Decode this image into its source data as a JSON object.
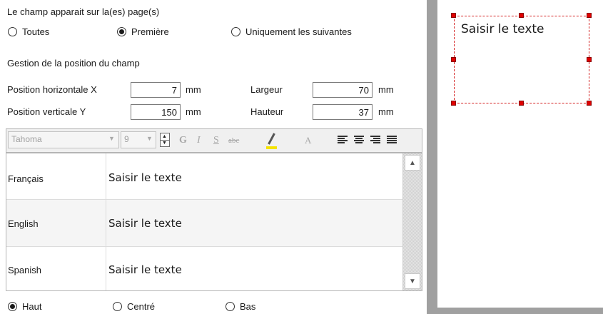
{
  "pages": {
    "heading": "Le champ apparait sur la(es) page(s)",
    "options": [
      {
        "label": "Toutes",
        "selected": false
      },
      {
        "label": "Première",
        "selected": true
      },
      {
        "label": "Uniquement les suivantes",
        "selected": false
      }
    ]
  },
  "position": {
    "heading": "Gestion de la position du champ",
    "horizontal_label": "Position horizontale X",
    "horizontal_value": "7",
    "vertical_label": "Position verticale Y",
    "vertical_value": "150",
    "width_label": "Largeur",
    "width_value": "70",
    "height_label": "Hauteur",
    "height_value": "37",
    "unit": "mm"
  },
  "toolbar": {
    "font": "Tahoma",
    "size": "9",
    "bold": "G",
    "italic": "I",
    "underline": "S",
    "strike": "abc",
    "font_color": "A",
    "highlight_color": "#f5e300",
    "icons": [
      "spin-icon",
      "bold-icon",
      "italic-icon",
      "underline-icon",
      "strikethrough-icon",
      "highlight-pen-icon",
      "font-color-icon",
      "align-left-icon",
      "align-center-icon",
      "align-right-icon",
      "align-justify-icon"
    ]
  },
  "translations": [
    {
      "language": "Français",
      "text": "Saisir le texte"
    },
    {
      "language": "English",
      "text": "Saisir le texte"
    },
    {
      "language": "Spanish",
      "text": "Saisir le texte"
    }
  ],
  "vertical_align": {
    "options": [
      {
        "label": "Haut",
        "selected": true
      },
      {
        "label": "Centré",
        "selected": false
      },
      {
        "label": "Bas",
        "selected": false
      }
    ]
  },
  "preview": {
    "text": "Saisir le texte",
    "selection_color": "#d42020"
  }
}
